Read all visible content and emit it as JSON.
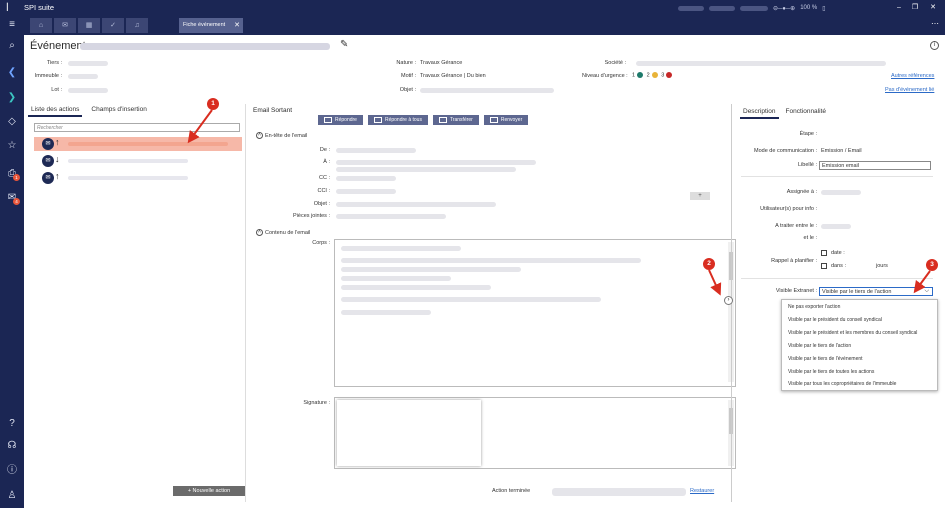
{
  "app": {
    "title": "SPI suite",
    "logo_icon": "spi-logo-icon"
  },
  "titlebar": {
    "zoom": "100 %"
  },
  "tabs": {
    "active": "Fiche événement"
  },
  "header": {
    "title": "Événement"
  },
  "fields": {
    "tiers": "Tiers :",
    "immeuble": "Immeuble :",
    "lot": "Lot :",
    "nature_label": "Nature :",
    "nature_value": "Travaux Gérance",
    "motif_label": "Motif :",
    "motif_value": "Travaux Gérance | Du bien",
    "objet_label": "Objet :",
    "societe_label": "Société :",
    "urgence_label": "Niveau d'urgence :",
    "urgence_1": "1",
    "urgence_2": "2",
    "urgence_3": "3",
    "autres_refs": "Autres références",
    "pas_evenement": "Pas d'événement lié"
  },
  "urgence_colors": {
    "c1": "#1e7a6b",
    "c2": "#e8b339",
    "c3": "#c62828"
  },
  "left_panel": {
    "tab_actions": "Liste des actions",
    "tab_insertion": "Champs d'insertion",
    "search_placeholder": "Rechercher",
    "new_action": "+ Nouvelle action"
  },
  "email": {
    "title": "Email Sortant",
    "btn_repondre": "Répondre",
    "btn_repondre_tous": "Répondre à tous",
    "btn_transferer": "Transférer",
    "btn_renvoyer": "Renvoyer",
    "entete": "En-tête de l'email",
    "de": "De :",
    "a": "À :",
    "cc": "CC :",
    "cci": "CCI :",
    "objet": "Objet :",
    "pieces": "Pièces jointes :",
    "add_btn": "+",
    "contenu": "Contenu de l'email",
    "corps": "Corps :",
    "signature": "Signature :",
    "action_terminee": "Action terminée",
    "restaurer": "Restaurer"
  },
  "right_panel": {
    "tab_description": "Description",
    "tab_fonctionnalite": "Fonctionnalité",
    "etape": "Étape :",
    "mode_label": "Mode de communication :",
    "mode_value": "Emission / Email",
    "libelle_label": "Libellé :",
    "libelle_value": "Emission email",
    "assignee": "Assignée à :",
    "utilisateurs": "Utilisateur(s) pour info :",
    "traiter": "A traiter entre le :",
    "et_le": "et le :",
    "rappel": "Rappel à planifier :",
    "date": "date :",
    "dans": "dans :",
    "jours": "jours",
    "extranet_label": "Visible Extranet :",
    "extranet_value": "Visible par le tiers de l'action"
  },
  "dropdown_options": [
    "Ne pas exporter l'action",
    "Visible par le président du conseil syndical",
    "Visible par le président et les membres du conseil syndical",
    "Visible par le tiers de l'action",
    "Visible par le tiers de l'événement",
    "Visible par le tiers de toutes les actions",
    "Visible par tous les copropriétaires de l'immeuble"
  ],
  "markers": {
    "m1": "1",
    "m2": "2",
    "m3": "3"
  },
  "nav_badges": {
    "b1": "1",
    "b2": "4"
  }
}
